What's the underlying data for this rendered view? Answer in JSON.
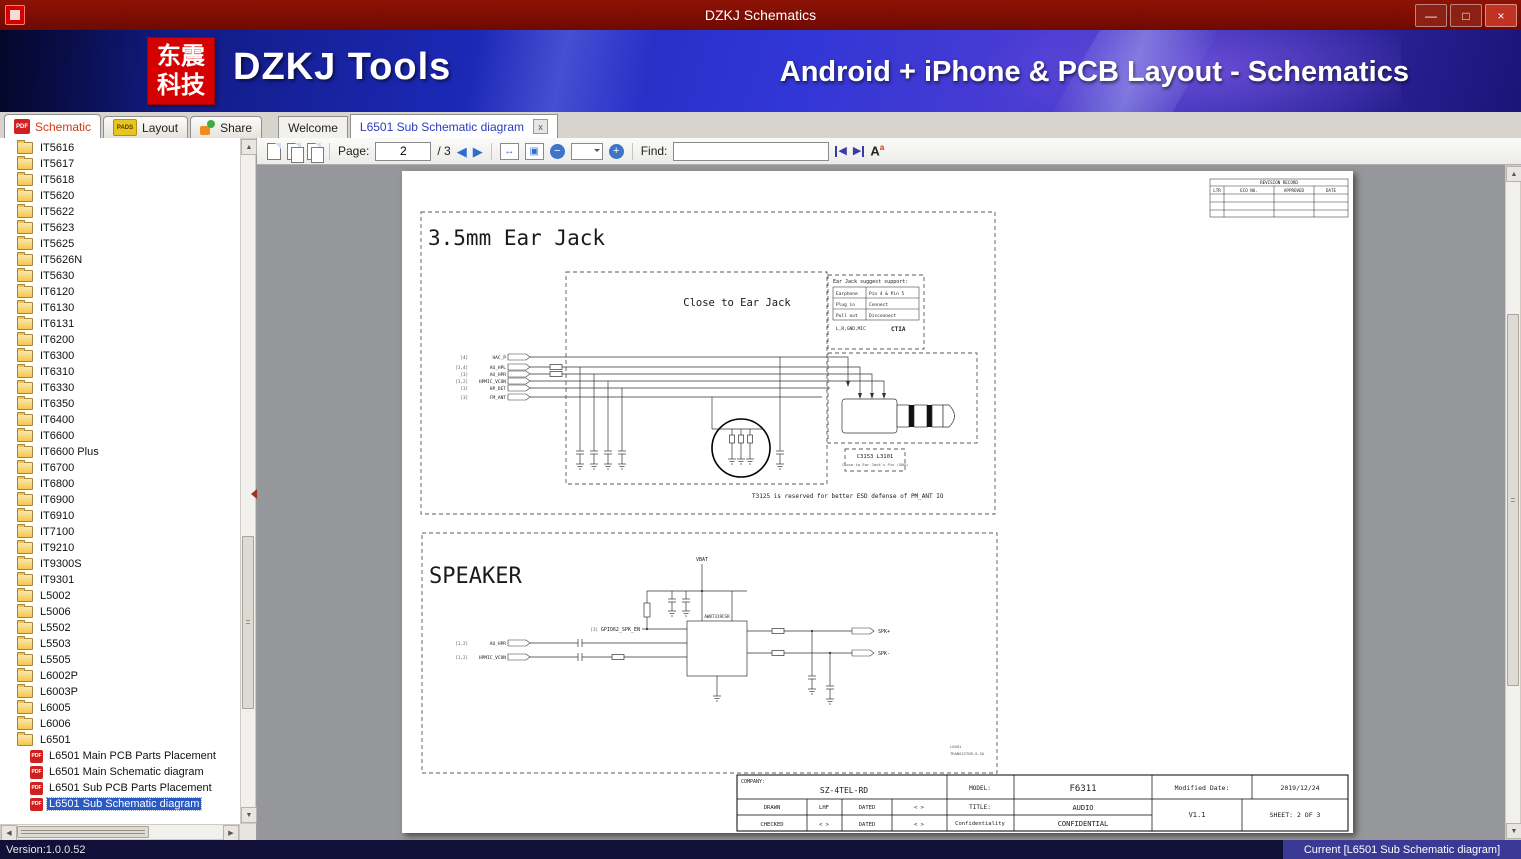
{
  "window": {
    "title": "DZKJ Schematics",
    "controls": {
      "minimize": "—",
      "maximize": "□",
      "close": "×"
    }
  },
  "banner": {
    "logo_line1": "东震",
    "logo_line2": "科技",
    "app_name": "DZKJ Tools",
    "tagline": "Android + iPhone & PCB Layout - Schematics"
  },
  "tabs": {
    "schematic": "Schematic",
    "layout": "Layout",
    "share": "Share",
    "welcome": "Welcome",
    "document": "L6501 Sub Schematic diagram",
    "pdf_badge": "PDF",
    "pads_badge": "PADS",
    "close_glyph": "x"
  },
  "sidebar": {
    "folders": [
      "IT5616",
      "IT5617",
      "IT5618",
      "IT5620",
      "IT5622",
      "IT5623",
      "IT5625",
      "IT5626N",
      "IT5630",
      "IT6120",
      "IT6130",
      "IT6131",
      "IT6200",
      "IT6300",
      "IT6310",
      "IT6330",
      "IT6350",
      "IT6400",
      "IT6600",
      "IT6600 Plus",
      "IT6700",
      "IT6800",
      "IT6900",
      "IT6910",
      "IT7100",
      "IT9210",
      "IT9300S",
      "IT9301",
      "L5002",
      "L5006",
      "L5502",
      "L5503",
      "L5505",
      "L6002P",
      "L6003P",
      "L6005",
      "L6006",
      "L6501"
    ],
    "pdf_items": [
      {
        "label": "L6501 Main PCB Parts Placement",
        "selected": false
      },
      {
        "label": "L6501 Main Schematic diagram",
        "selected": false
      },
      {
        "label": "L6501 Sub PCB Parts Placement",
        "selected": false
      },
      {
        "label": "L6501 Sub Schematic diagram",
        "selected": true
      }
    ]
  },
  "toolbar": {
    "page_label": "Page:",
    "page_value": "2",
    "page_total": "/ 3",
    "find_label": "Find:",
    "find_value": "",
    "icons": {
      "prev": "◀",
      "next": "▶",
      "fit_width": "↔",
      "fit_page": "▣",
      "zoom_out": "−",
      "zoom_in": "+",
      "find_prev": "◀",
      "find_next": "▶",
      "font_big": "A",
      "font_small": "a"
    }
  },
  "scrollbar_glyphs": {
    "up": "▲",
    "down": "▼",
    "left": "◀",
    "right": "▶"
  },
  "schematic": {
    "earjack": {
      "title": "3.5mm Ear Jack",
      "close_label": "Close to Ear Jack",
      "support_title": "Ear Jack suggest support:",
      "support_rows": [
        [
          "Earphone",
          "Pin 4 & Pin 5"
        ],
        [
          "Plug in",
          "Connect"
        ],
        [
          "Pull out",
          "Disconnect"
        ]
      ],
      "support_footer": "L,R,GND,MIC",
      "support_std": "CTIA",
      "signals": [
        {
          "pins": "[4]",
          "name": "HAC_P"
        },
        {
          "pins": "[3,4]",
          "name": "AU_HPL"
        },
        {
          "pins": "[3]",
          "name": "AU_HPR"
        },
        {
          "pins": "[1,2]",
          "name": "HPMIC_VCON"
        },
        {
          "pins": "[3]",
          "name": "HP_DET"
        },
        {
          "pins": "[3]",
          "name": "FM_ANT"
        }
      ],
      "callout_line1": "C3153 L3101",
      "callout_line2": "Close to Ear Jack's Pin (GND)",
      "note": "T3125 is reserved for better ESD defense of PM_ANT IO"
    },
    "speaker": {
      "title": "SPEAKER",
      "vbat": "VBAT",
      "enable_pins": "[3]",
      "enable": "GPIO62_SPK_EN",
      "in1_pins": "[1,2]",
      "in1": "AU_HPR",
      "in2_pins": "[1,2]",
      "in2": "HPMIC_VCON",
      "chip": "AW87319CSR",
      "outp": "SPK+",
      "outn": "SPK-",
      "misc1": "L0501",
      "misc2": "TRANSISTOR-0.5A"
    },
    "revision": {
      "title": "REVISION RECORD",
      "cols": [
        "LTR",
        "ECO NO.",
        "APPROVED",
        "DATE"
      ]
    },
    "titleblock": {
      "company_label": "COMPANY:",
      "company": "SZ-4TEL-RD",
      "model_label": "MODEL:",
      "model": "F6311",
      "modified_label": "Modified Date:",
      "modified": "2019/12/24",
      "drawn_label": "DRAWN",
      "drawn": "LHF",
      "dated_label": "DATED",
      "angle": "< >",
      "title_label": "TITLE:",
      "title": "AUDIO",
      "checked_label": "CHECKED",
      "conf_label": "Confidentiality",
      "conf": "CONFIDENTIAL",
      "version": "V1.1",
      "sheet": "SHEET: 2  OF  3"
    }
  },
  "statusbar": {
    "version": "Version:1.0.0.52",
    "current": "Current [L6501 Sub Schematic diagram]"
  }
}
